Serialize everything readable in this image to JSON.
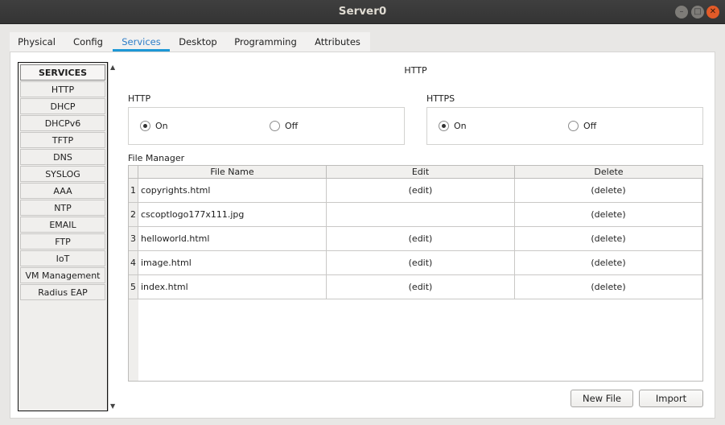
{
  "window": {
    "title": "Server0"
  },
  "tabs": [
    {
      "label": "Physical"
    },
    {
      "label": "Config"
    },
    {
      "label": "Services",
      "active": true
    },
    {
      "label": "Desktop"
    },
    {
      "label": "Programming"
    },
    {
      "label": "Attributes"
    }
  ],
  "sidebar": {
    "header": "SERVICES",
    "items": [
      {
        "label": "HTTP"
      },
      {
        "label": "DHCP"
      },
      {
        "label": "DHCPv6"
      },
      {
        "label": "TFTP"
      },
      {
        "label": "DNS"
      },
      {
        "label": "SYSLOG"
      },
      {
        "label": "AAA"
      },
      {
        "label": "NTP"
      },
      {
        "label": "EMAIL"
      },
      {
        "label": "FTP"
      },
      {
        "label": "IoT"
      },
      {
        "label": "VM Management"
      },
      {
        "label": "Radius EAP"
      }
    ]
  },
  "main": {
    "heading": "HTTP",
    "http": {
      "label": "HTTP",
      "on_label": "On",
      "off_label": "Off",
      "selected": "On"
    },
    "https": {
      "label": "HTTPS",
      "on_label": "On",
      "off_label": "Off",
      "selected": "On"
    },
    "file_manager": {
      "label": "File Manager",
      "columns": [
        "File Name",
        "Edit",
        "Delete"
      ],
      "rows": [
        {
          "num": "1",
          "name": "copyrights.html",
          "edit": "(edit)",
          "delete": "(delete)"
        },
        {
          "num": "2",
          "name": "cscoptlogo177x111.jpg",
          "edit": "",
          "delete": "(delete)"
        },
        {
          "num": "3",
          "name": "helloworld.html",
          "edit": "(edit)",
          "delete": "(delete)"
        },
        {
          "num": "4",
          "name": "image.html",
          "edit": "(edit)",
          "delete": "(delete)"
        },
        {
          "num": "5",
          "name": "index.html",
          "edit": "(edit)",
          "delete": "(delete)"
        }
      ]
    },
    "buttons": {
      "new_file": "New File",
      "import": "Import"
    }
  },
  "colors": {
    "accent": "#1d98d6",
    "close_button": "#e35b28",
    "titlebar": "#3b3b3b"
  }
}
